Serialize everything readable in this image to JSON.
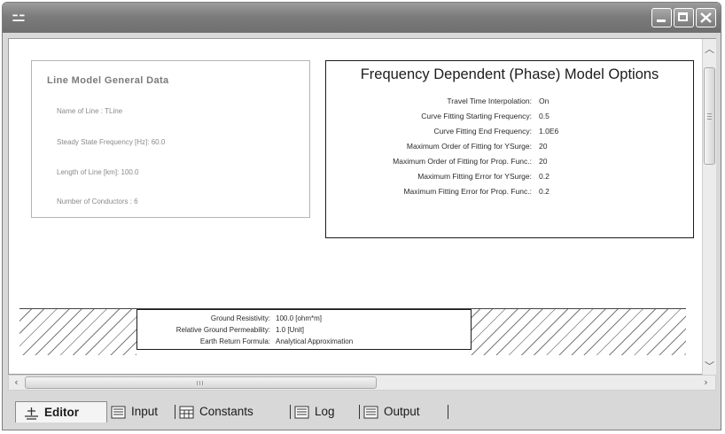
{
  "window": {
    "app_icon": "antenna-icon",
    "controls": [
      "minimize-icon",
      "maximize-icon",
      "close-icon"
    ]
  },
  "line_model": {
    "title": "Line Model General Data",
    "fields": [
      "Name of Line : TLine",
      "Steady State Frequency [Hz]: 60.0",
      "Length of Line [km]: 100.0",
      "Number of Conductors : 6"
    ]
  },
  "fd_options": {
    "title": "Frequency Dependent (Phase) Model Options",
    "rows": [
      {
        "label": "Travel Time Interpolation:",
        "value": "On"
      },
      {
        "label": "Curve Fitting Starting Frequency:",
        "value": "0.5"
      },
      {
        "label": "Curve Fitting End Frequency:",
        "value": "1.0E6"
      },
      {
        "label": "Maximum Order of Fitting for YSurge:",
        "value": "20"
      },
      {
        "label": "Maximum Order of Fitting for Prop. Func.:",
        "value": "20"
      },
      {
        "label": "Maximum Fitting Error for YSurge:",
        "value": "0.2"
      },
      {
        "label": "Maximum Fitting Error for Prop. Func.:",
        "value": "0.2"
      }
    ]
  },
  "ground": {
    "rows": [
      {
        "label": "Ground Resistivity:",
        "value": "100.0 [ohm*m]"
      },
      {
        "label": "Relative Ground Permeability:",
        "value": "1.0 [Unit]"
      },
      {
        "label": "Earth Return Formula:",
        "value": "Analytical Approximation"
      }
    ]
  },
  "tabs": [
    {
      "label": "Editor",
      "icon": "antenna-icon",
      "active": true
    },
    {
      "label": "Input",
      "icon": "document-icon",
      "active": false
    },
    {
      "label": "Constants",
      "icon": "table-icon",
      "active": false
    },
    {
      "label": "Log",
      "icon": "document-icon",
      "active": false
    },
    {
      "label": "Output",
      "icon": "document-icon",
      "active": false
    }
  ]
}
